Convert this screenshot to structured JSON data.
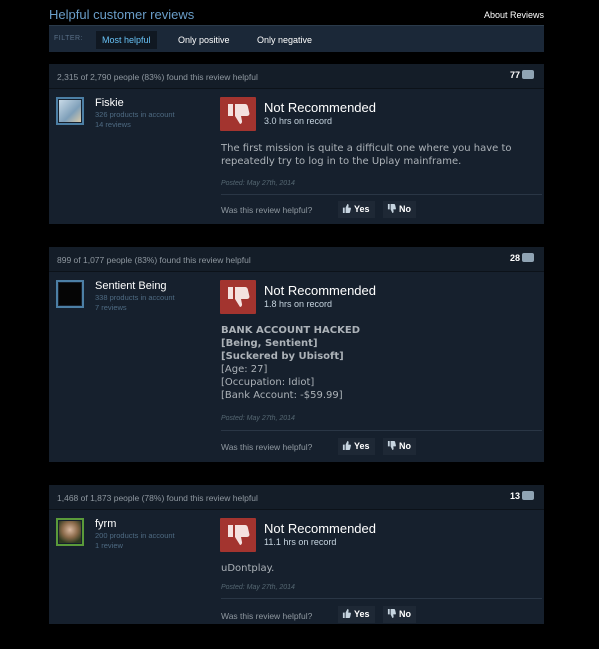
{
  "header": {
    "title": "Helpful customer reviews",
    "about": "About Reviews"
  },
  "filter": {
    "label": "FILTER:",
    "tabs": [
      "Most helpful",
      "Only positive",
      "Only negative"
    ]
  },
  "reviews": [
    {
      "helpful": "2,315 of 2,790 people (83%) found this review helpful",
      "count": "77",
      "user": "Fiskie",
      "products": "326 products in account",
      "reviews": "14 reviews",
      "verdict": "Not Recommended",
      "hours": "3.0 hrs on record",
      "lines": [
        "The first mission is quite a difficult one where you have to",
        "repeatedly try to log in to the Uplay mainframe."
      ],
      "posted": "Posted: May 27th, 2014",
      "question": "Was this review helpful?",
      "yes": "Yes",
      "no": "No",
      "avatar_color": "#8db0c9"
    },
    {
      "helpful": "899 of 1,077 people (83%) found this review helpful",
      "count": "28",
      "user": "Sentient Being",
      "products": "338 products in account",
      "reviews": "7 reviews",
      "verdict": "Not Recommended",
      "hours": "1.8 hrs on record",
      "lines": [
        "BANK ACCOUNT HACKED",
        "[Being, Sentient]",
        "[Suckered by Ubisoft]",
        "[Age: 27]",
        "[Occupation: Idiot]",
        "[Bank Account: -$59.99]"
      ],
      "posted": "Posted: May 27th, 2014",
      "question": "Was this review helpful?",
      "yes": "Yes",
      "no": "No",
      "avatar_color": "#050505"
    },
    {
      "helpful": "1,468 of 1,873 people (78%) found this review helpful",
      "count": "13",
      "user": "fyrm",
      "products": "200 products in account",
      "reviews": "1 review",
      "verdict": "Not Recommended",
      "hours": "11.1 hrs on record",
      "lines": [
        "uDontplay."
      ],
      "posted": "Posted: May 27th, 2014",
      "question": "Was this review helpful?",
      "yes": "Yes",
      "no": "No",
      "avatar_color": "#6b5a3a"
    }
  ],
  "colors": {
    "accent": "#67c1f5",
    "thumbs_down": "#a3342f",
    "panel": "#16202d"
  }
}
